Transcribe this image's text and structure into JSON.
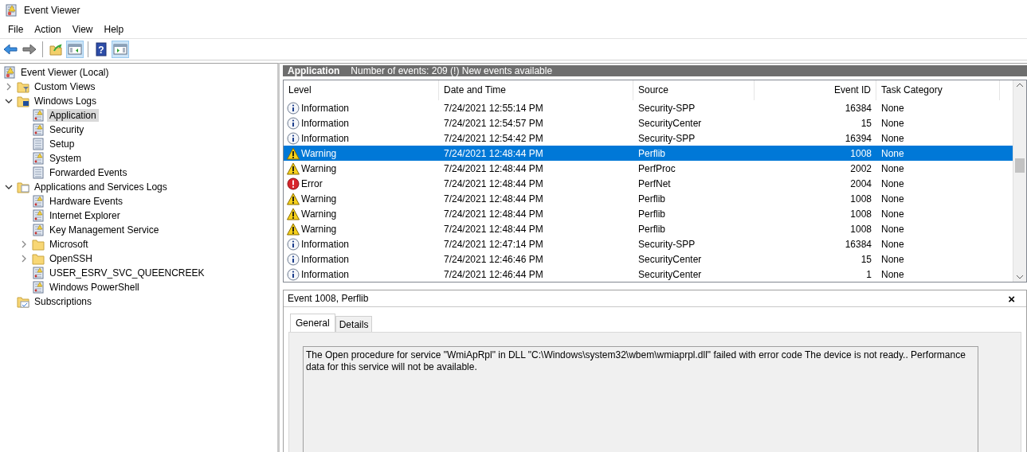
{
  "window": {
    "title": "Event Viewer"
  },
  "menu": [
    "File",
    "Action",
    "View",
    "Help"
  ],
  "toolbar": [
    {
      "kind": "back",
      "pressed": false
    },
    {
      "kind": "forward",
      "pressed": false
    },
    {
      "kind": "sep"
    },
    {
      "kind": "folder",
      "pressed": false
    },
    {
      "kind": "tree",
      "pressed": true
    },
    {
      "kind": "sep"
    },
    {
      "kind": "help",
      "text": "?",
      "pressed": false
    },
    {
      "kind": "pane",
      "pressed": true
    }
  ],
  "tree": [
    {
      "label": "Event Viewer (Local)",
      "kind": "root",
      "selected": false,
      "children": [
        {
          "label": "Custom Views",
          "kind": "filter-folder",
          "expanded": false,
          "selected": false
        },
        {
          "label": "Windows Logs",
          "kind": "log-folder",
          "expanded": true,
          "selected": false,
          "children": [
            {
              "label": "Application",
              "kind": "log",
              "selected": true
            },
            {
              "label": "Security",
              "kind": "log",
              "selected": false
            },
            {
              "label": "Setup",
              "kind": "plain-log",
              "selected": false
            },
            {
              "label": "System",
              "kind": "log",
              "selected": false
            },
            {
              "label": "Forwarded Events",
              "kind": "plain-log",
              "selected": false
            }
          ]
        },
        {
          "label": "Applications and Services Logs",
          "kind": "folder-open",
          "expanded": true,
          "selected": false,
          "children": [
            {
              "label": "Hardware Events",
              "kind": "log",
              "selected": false
            },
            {
              "label": "Internet Explorer",
              "kind": "log",
              "selected": false
            },
            {
              "label": "Key Management Service",
              "kind": "log",
              "selected": false
            },
            {
              "label": "Microsoft",
              "kind": "folder",
              "expanded": false,
              "selected": false
            },
            {
              "label": "OpenSSH",
              "kind": "folder",
              "expanded": false,
              "selected": false
            },
            {
              "label": "USER_ESRV_SVC_QUEENCREEK",
              "kind": "log",
              "selected": false
            },
            {
              "label": "Windows PowerShell",
              "kind": "log",
              "selected": false
            }
          ]
        },
        {
          "label": "Subscriptions",
          "kind": "subscription",
          "selected": false
        }
      ]
    }
  ],
  "log_header": {
    "title": "Application",
    "summary": "Number of events: 209 (!) New events available"
  },
  "table": {
    "columns": [
      "Level",
      "Date and Time",
      "Source",
      "Event ID",
      "Task Category"
    ],
    "rows": [
      {
        "kind": "information",
        "level": "Information",
        "date": "7/24/2021 12:55:14 PM",
        "source": "Security-SPP",
        "id": "16384",
        "category": "None",
        "selected": false
      },
      {
        "kind": "information",
        "level": "Information",
        "date": "7/24/2021 12:54:57 PM",
        "source": "SecurityCenter",
        "id": "15",
        "category": "None",
        "selected": false
      },
      {
        "kind": "information",
        "level": "Information",
        "date": "7/24/2021 12:54:42 PM",
        "source": "Security-SPP",
        "id": "16394",
        "category": "None",
        "selected": false
      },
      {
        "kind": "warning",
        "level": "Warning",
        "date": "7/24/2021 12:48:44 PM",
        "source": "Perflib",
        "id": "1008",
        "category": "None",
        "selected": true
      },
      {
        "kind": "warning",
        "level": "Warning",
        "date": "7/24/2021 12:48:44 PM",
        "source": "PerfProc",
        "id": "2002",
        "category": "None",
        "selected": false
      },
      {
        "kind": "error",
        "level": "Error",
        "date": "7/24/2021 12:48:44 PM",
        "source": "PerfNet",
        "id": "2004",
        "category": "None",
        "selected": false
      },
      {
        "kind": "warning",
        "level": "Warning",
        "date": "7/24/2021 12:48:44 PM",
        "source": "Perflib",
        "id": "1008",
        "category": "None",
        "selected": false
      },
      {
        "kind": "warning",
        "level": "Warning",
        "date": "7/24/2021 12:48:44 PM",
        "source": "Perflib",
        "id": "1008",
        "category": "None",
        "selected": false
      },
      {
        "kind": "warning",
        "level": "Warning",
        "date": "7/24/2021 12:48:44 PM",
        "source": "Perflib",
        "id": "1008",
        "category": "None",
        "selected": false
      },
      {
        "kind": "information",
        "level": "Information",
        "date": "7/24/2021 12:47:14 PM",
        "source": "Security-SPP",
        "id": "16384",
        "category": "None",
        "selected": false
      },
      {
        "kind": "information",
        "level": "Information",
        "date": "7/24/2021 12:46:46 PM",
        "source": "SecurityCenter",
        "id": "15",
        "category": "None",
        "selected": false
      },
      {
        "kind": "information",
        "level": "Information",
        "date": "7/24/2021 12:46:44 PM",
        "source": "SecurityCenter",
        "id": "1",
        "category": "None",
        "selected": false
      }
    ]
  },
  "detail": {
    "title": "Event 1008, Perflib",
    "close": "×",
    "tabs": [
      {
        "label": "General",
        "selected": true
      },
      {
        "label": "Details",
        "selected": false
      }
    ],
    "message": "The Open procedure for service \"WmiApRpl\" in DLL \"C:\\Windows\\system32\\wbem\\wmiaprpl.dll\" failed with error code The device is not ready.. Performance data for this service will not be available."
  }
}
